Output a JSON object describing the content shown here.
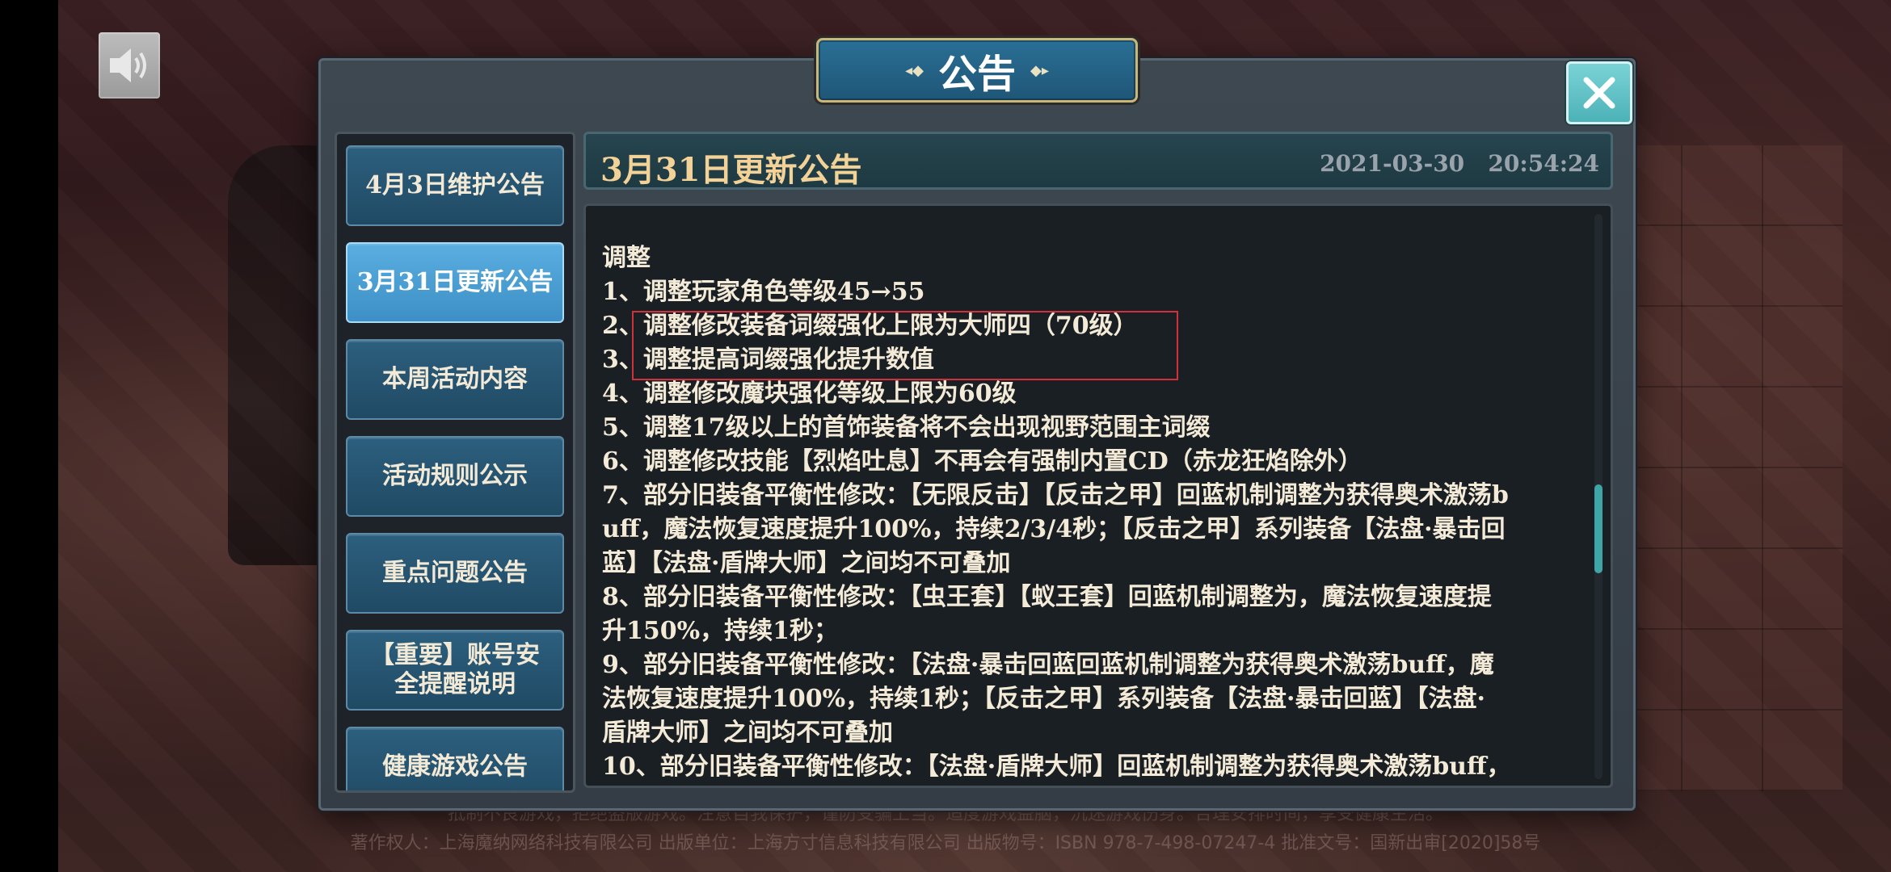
{
  "dialog": {
    "title": "公告",
    "close_label": "✕"
  },
  "sidebar": {
    "tabs": [
      {
        "label": "4月3日维护公告",
        "active": false
      },
      {
        "label": "3月31日更新公告",
        "active": true
      },
      {
        "label": "本周活动内容",
        "active": false
      },
      {
        "label": "活动规则公示",
        "active": false
      },
      {
        "label": "重点问题公告",
        "active": false
      },
      {
        "label": "【重要】账号安全提醒说明",
        "active": false
      },
      {
        "label": "健康游戏公告",
        "active": false
      }
    ]
  },
  "announcement": {
    "title": "3月31日更新公告",
    "date": "2021-03-30",
    "time": "20:54:24",
    "lines": [
      "调整",
      "1、调整玩家角色等级45→55",
      "2、调整修改装备词缀强化上限为大师四（70级）",
      "3、调整提高词缀强化提升数值",
      "4、调整修改魔块强化等级上限为60级",
      "5、调整17级以上的首饰装备将不会出现视野范围主词缀",
      "6、调整修改技能【烈焰吐息】不再会有强制内置CD（赤龙狂焰除外）",
      "7、部分旧装备平衡性修改：【无限反击】【反击之甲】回蓝机制调整为获得奥术激荡b",
      "uff，魔法恢复速度提升100%，持续2/3/4秒；【反击之甲】系列装备【法盘·暴击回",
      "蓝】【法盘·盾牌大师】之间均不可叠加",
      "8、部分旧装备平衡性修改：【虫王套】【蚁王套】回蓝机制调整为，魔法恢复速度提",
      "升150%，持续1秒；",
      "9、部分旧装备平衡性修改：【法盘·暴击回蓝回蓝机制调整为获得奥术激荡buff，魔",
      "法恢复速度提升100%，持续1秒；【反击之甲】系列装备【法盘·暴击回蓝】【法盘·",
      "盾牌大师】之间均不可叠加",
      "10、部分旧装备平衡性修改：【法盘·盾牌大师】回蓝机制调整为获得奥术激荡buff，"
    ]
  },
  "footer": {
    "line1": "抵制不良游戏，拒绝盗版游戏。注意自我保护，谨防受骗上当。适度游戏益脑，沉迷游戏伤身。合理安排时间，享受健康生活。",
    "line2": "著作权人：上海魔纳网络科技有限公司  出版单位：上海方寸信息科技有限公司  出版物号：ISBN 978-7-498-07247-4  批准文号：国新出审[2020]58号"
  },
  "colors": {
    "accent_active_tab": "#4a9fd4",
    "title_gold": "#f2d296",
    "highlight_red": "#d0313a",
    "close_teal": "#5cc0c5"
  },
  "icons": {
    "speaker": "speaker-icon",
    "close": "close-icon"
  }
}
